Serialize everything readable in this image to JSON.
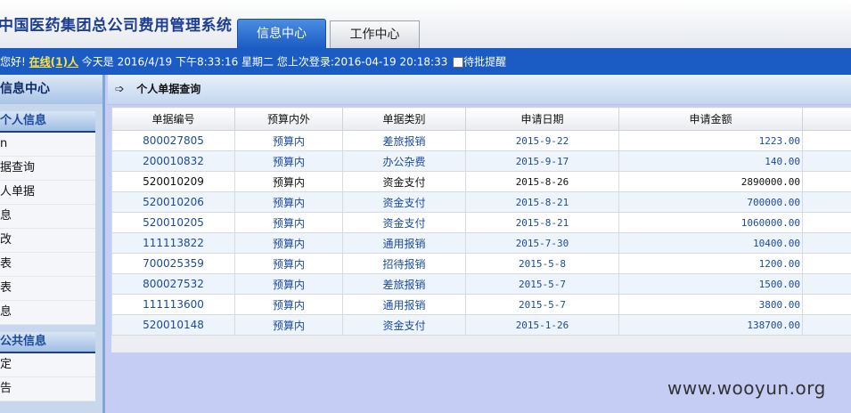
{
  "header": {
    "system_title": "中国医药集团总公司费用管理系统",
    "tabs": [
      {
        "label": "信息中心",
        "active": true
      },
      {
        "label": "工作中心",
        "active": false
      }
    ]
  },
  "status": {
    "greeting": "您好!",
    "online_link": "在线(1)人",
    "date_text": "今天是 2016/4/19 下午8:33:16 星期二  您上次登录:2016-04-19 20:18:33",
    "checkbox_label": "待批提醒",
    "checkbox_checked": false
  },
  "sidebar": {
    "title": "信息中心",
    "sections": [
      {
        "title": "个人信息",
        "items": [
          "n",
          "据查询",
          "人单据",
          "息",
          "改",
          "表",
          "表",
          "息"
        ]
      },
      {
        "title": "公共信息",
        "items": [
          "定",
          "告"
        ]
      }
    ]
  },
  "main": {
    "title": "个人单据查询",
    "table": {
      "columns": [
        "单据编号",
        "预算内外",
        "单据类别",
        "申请日期",
        "申请金额",
        ""
      ],
      "rows": [
        [
          "800027805",
          "预算内",
          "差旅报销",
          "2015-9-22",
          "1223.00",
          ""
        ],
        [
          "200010832",
          "预算内",
          "办公杂费",
          "2015-9-17",
          "140.00",
          ""
        ],
        [
          "520010209",
          "预算内",
          "资金支付",
          "2015-8-26",
          "2890000.00",
          ""
        ],
        [
          "520010206",
          "预算内",
          "资金支付",
          "2015-8-21",
          "700000.00",
          ""
        ],
        [
          "520010205",
          "预算内",
          "资金支付",
          "2015-8-21",
          "1060000.00",
          ""
        ],
        [
          "111113822",
          "预算内",
          "通用报销",
          "2015-7-30",
          "10400.00",
          ""
        ],
        [
          "700025359",
          "预算内",
          "招待报销",
          "2015-5-8",
          "1200.00",
          ""
        ],
        [
          "800027532",
          "预算内",
          "差旅报销",
          "2015-5-7",
          "1500.00",
          ""
        ],
        [
          "111113600",
          "预算内",
          "通用报销",
          "2015-5-7",
          "3800.00",
          ""
        ],
        [
          "520010148",
          "预算内",
          "资金支付",
          "2015-1-26",
          "138700.00",
          ""
        ]
      ]
    }
  },
  "watermark": "www.wooyun.org",
  "colors": {
    "accent": "#1b5cc4",
    "link": "#1a4a9c",
    "highlight": "#ffe23c"
  }
}
